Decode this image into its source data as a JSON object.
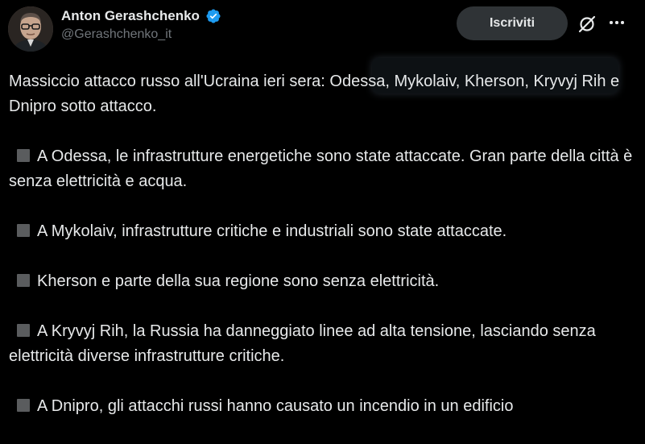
{
  "author": {
    "display_name": "Anton Gerashchenko",
    "handle": "@Gerashchenko_it",
    "verified": true,
    "verified_color": "#1d9bf0"
  },
  "actions": {
    "subscribe_label": "Iscriviti",
    "grok_icon": "slashed-circle-icon",
    "more_icon": "more-horizontal-icon"
  },
  "tweet": {
    "intro": "Massiccio attacco russo all'Ucraina ieri sera: Odessa, Mykolaiv, Kherson, Kryvyj Rih e Dnipro sotto attacco.",
    "bullets": [
      "A Odessa, le infrastrutture energetiche sono state attaccate. Gran parte della città è senza elettricità e acqua.",
      "A Mykolaiv, infrastrutture critiche e industriali sono state attaccate.",
      "Kherson e parte della sua regione sono senza elettricità.",
      "A Kryvyj Rih, la Russia ha danneggiato linee ad alta tensione, lasciando senza elettricità diverse infrastrutture critiche.",
      "A Dnipro, gli attacchi russi hanno causato un incendio in un edificio"
    ],
    "bullet_icon": "black-square-icon"
  },
  "colors": {
    "background": "#000000",
    "text": "#e7e9ea",
    "secondary_text": "#71767b",
    "button_background": "#2f3336"
  }
}
